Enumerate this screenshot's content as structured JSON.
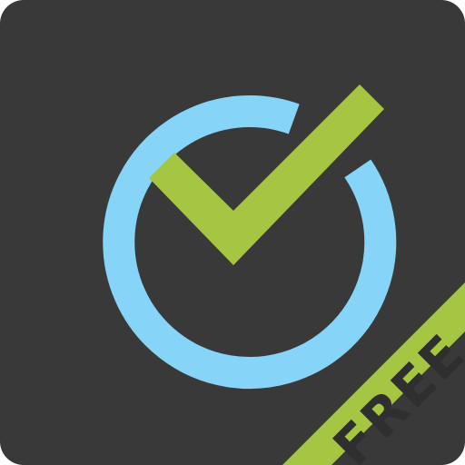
{
  "app_icon": {
    "badge_label": "FREE",
    "icon": "clock-checkmark-icon",
    "colors": {
      "background": "#393939",
      "ring": "#86d5f8",
      "checkmark": "#a6c542",
      "ribbon": "#a6c542",
      "ribbon_text": "#2f2f2f"
    }
  }
}
